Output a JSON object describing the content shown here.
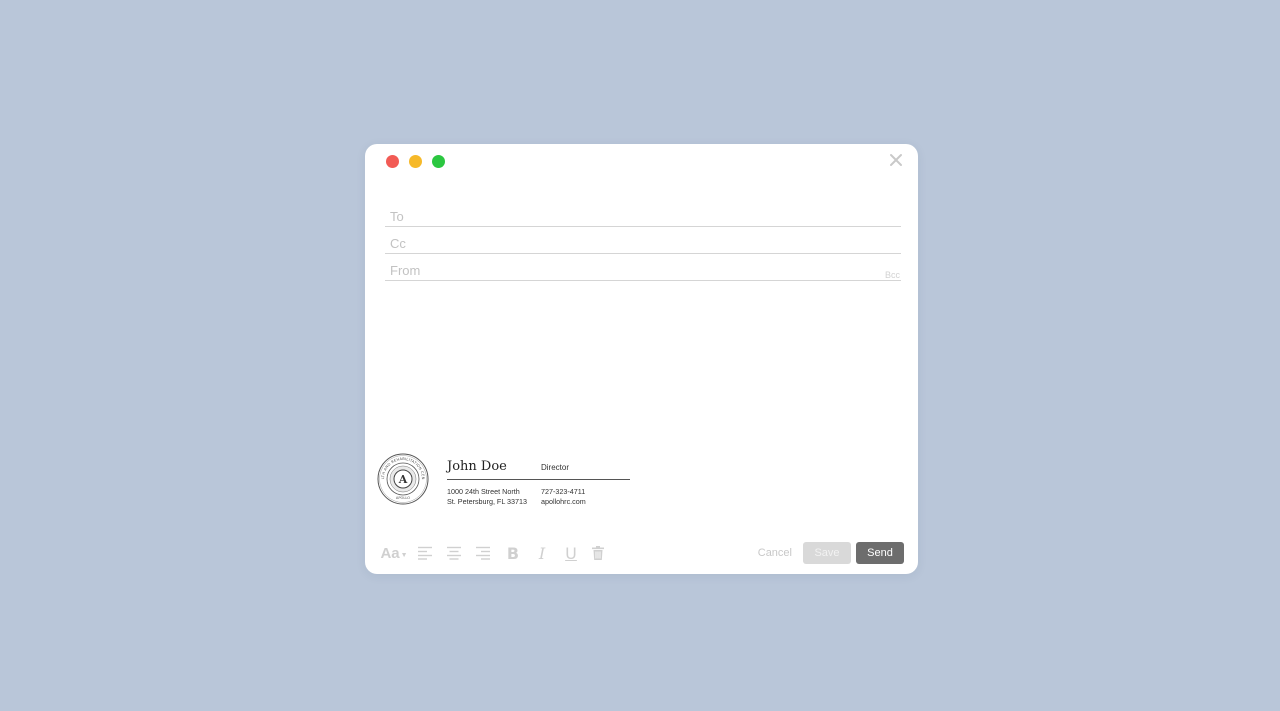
{
  "window": {
    "controls": {
      "close_color": "#f25b55",
      "minimize_color": "#f6b929",
      "zoom_color": "#2bc740"
    },
    "close_icon": "close-x-icon"
  },
  "fields": {
    "to_placeholder": "To",
    "cc_placeholder": "Cc",
    "from_placeholder": "From",
    "bcc_label": "Bcc"
  },
  "signature": {
    "name": "John Doe",
    "title": "Director",
    "address_line1": "1000 24th Street North",
    "address_line2": "St. Petersburg, FL 33713",
    "phone": "727-323-4711",
    "website": "apollohrc.com",
    "seal": {
      "outer_text": "HEALTH AND REHABILITATION CENTER",
      "bottom_text": "APOLLO",
      "center_letter": "A"
    }
  },
  "toolbar": {
    "font_label": "Aa",
    "icons": [
      "align-left-icon",
      "align-center-icon",
      "align-right-icon",
      "bold-icon",
      "italic-icon",
      "underline-icon",
      "trash-icon"
    ],
    "bold_label": "B",
    "italic_label": "I",
    "underline_label": "U"
  },
  "actions": {
    "cancel_label": "Cancel",
    "save_label": "Save",
    "send_label": "Send",
    "send_color": "#6d6d6d"
  }
}
